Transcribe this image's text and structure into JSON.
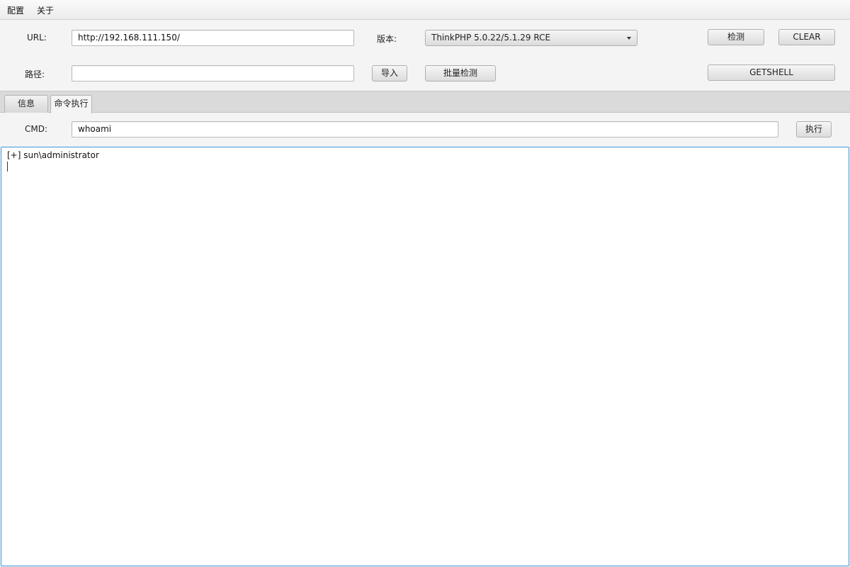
{
  "menu": {
    "config": "配置",
    "about": "关于"
  },
  "form": {
    "url_label": "URL:",
    "url_value": "http://192.168.111.150/",
    "version_label": "版本:",
    "version_value": "ThinkPHP 5.0.22/5.1.29 RCE",
    "path_label": "路径:",
    "path_value": ""
  },
  "buttons": {
    "detect": "检测",
    "clear": "CLEAR",
    "import": "导入",
    "batch_detect": "批量检测",
    "getshell": "GETSHELL",
    "execute": "执行"
  },
  "tabs": [
    {
      "label": "信息",
      "active": false
    },
    {
      "label": "命令执行",
      "active": true
    }
  ],
  "cmd": {
    "label": "CMD:",
    "value": "whoami"
  },
  "output": {
    "lines": [
      "[+] sun\\administrator"
    ]
  }
}
